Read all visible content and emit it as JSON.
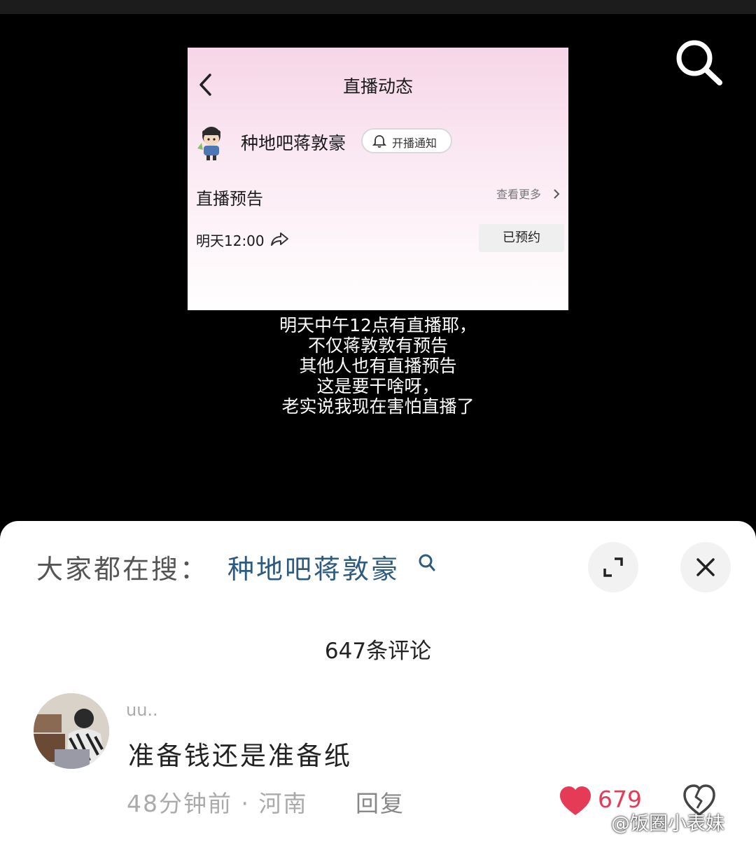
{
  "card": {
    "title": "直播动态",
    "username": "种地吧蒋敦豪",
    "notify_label": "开播通知",
    "section_title": "直播预告",
    "more_label": "查看更多",
    "time": "明天12:00",
    "booked_label": "已预约"
  },
  "caption": [
    "明天中午12点有直播耶，",
    "不仅蒋敦敦有预告",
    "其他人也有直播预告",
    "这是要干啥呀，",
    "老实说我现在害怕直播了"
  ],
  "sheet": {
    "hot_label": "大家都在搜：",
    "hot_term": "种地吧蒋敦豪",
    "comment_count": "647条评论",
    "comment": {
      "user": "uu..",
      "text": "准备钱还是准备纸",
      "meta": "48分钟前 · 河南",
      "reply_label": "回复",
      "likes": "679"
    }
  },
  "watermark": "@饭圈小表妹",
  "colors": {
    "like": "#e63b57",
    "hot_term": "#2d5a80"
  }
}
